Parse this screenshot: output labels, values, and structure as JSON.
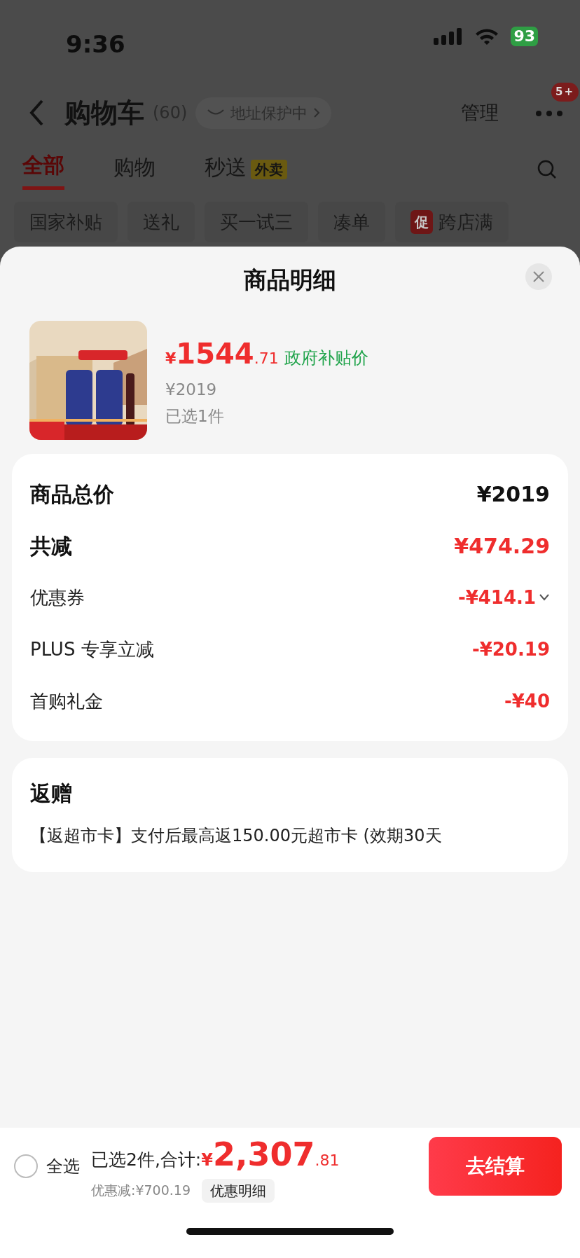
{
  "status_bar": {
    "time": "9:36",
    "battery": "93"
  },
  "header": {
    "title": "购物车",
    "count": "(60)",
    "address_pill": "地址保护中",
    "manage": "管理",
    "more_badge": "5+"
  },
  "tabs": [
    {
      "label": "全部",
      "selected": true
    },
    {
      "label": "购物",
      "selected": false
    },
    {
      "label": "秒送",
      "badge": "外卖",
      "selected": false
    }
  ],
  "filter_chips": [
    {
      "label": "国家补贴"
    },
    {
      "label": "送礼"
    },
    {
      "label": "买一试三"
    },
    {
      "label": "凑单"
    },
    {
      "label": "跨店满",
      "tag": "促"
    }
  ],
  "sheet": {
    "title": "商品明细",
    "product": {
      "price_symbol": "¥",
      "price_int": "1544",
      "price_dec": ".71",
      "price_label": "政府补贴价",
      "original_price": "¥2019",
      "selected_count": "已选1件"
    },
    "summary": [
      {
        "label": "商品总价",
        "value": "¥2019",
        "kind": "total",
        "expandable": false
      },
      {
        "label": "共减",
        "value": "¥474.29",
        "kind": "reduction",
        "expandable": false
      },
      {
        "label": "优惠券",
        "value": "-¥414.1",
        "kind": "discount",
        "expandable": true
      },
      {
        "label": "PLUS 专享立减",
        "value": "-¥20.19",
        "kind": "discount",
        "expandable": false
      },
      {
        "label": "首购礼金",
        "value": "-¥40",
        "kind": "discount",
        "expandable": false
      }
    ],
    "rebate": {
      "title": "返赠",
      "text": "【返超市卡】支付后最高返150.00元超市卡 (效期30天"
    }
  },
  "bottom_bar": {
    "select_all": {
      "label": "全选",
      "checked": false
    },
    "summary_label": "已选2件,合计:",
    "total_symbol": "¥",
    "total_int": "2,307",
    "total_dec": ".81",
    "savings": "优惠减:¥700.19",
    "detail_button": "优惠明细",
    "checkout": "去结算"
  }
}
